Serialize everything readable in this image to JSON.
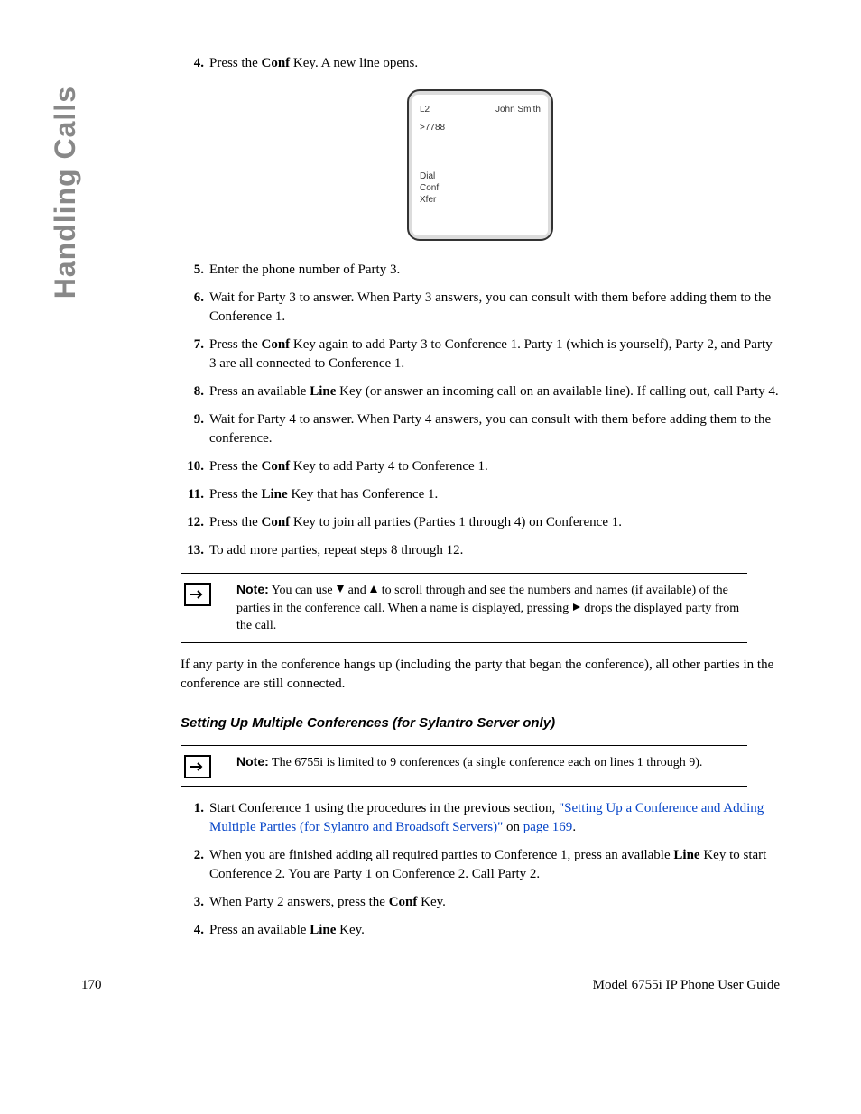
{
  "sideTitle": "Handling Calls",
  "phone": {
    "line": "L2",
    "name": "John Smith",
    "number": ">7788",
    "softkeys": [
      "Dial",
      "Conf",
      "Xfer"
    ]
  },
  "stepsA": [
    {
      "n": "4.",
      "pre": "Press the ",
      "bold": "Conf",
      "post": " Key. A new line opens."
    },
    {
      "n": "5.",
      "pre": "Enter the phone number of Party 3.",
      "bold": "",
      "post": ""
    },
    {
      "n": "6.",
      "pre": "Wait for Party 3 to answer. When Party 3 answers, you can consult with them before adding them to the Conference 1.",
      "bold": "",
      "post": ""
    },
    {
      "n": "7.",
      "pre": "Press the ",
      "bold": "Conf",
      "post": " Key again to add Party 3 to Conference 1. Party 1 (which is yourself), Party 2, and Party 3 are all connected to Conference 1."
    },
    {
      "n": "8.",
      "pre": "Press an available ",
      "bold": "Line",
      "post": " Key (or answer an incoming call on an available line). If calling out, call Party 4."
    },
    {
      "n": "9.",
      "pre": "Wait for Party 4 to answer. When Party 4 answers, you can consult with them before adding them to the conference.",
      "bold": "",
      "post": ""
    },
    {
      "n": "10.",
      "pre": "Press the ",
      "bold": "Conf",
      "post": " Key to add Party 4 to Conference 1."
    },
    {
      "n": "11.",
      "pre": "Press the ",
      "bold": "Line",
      "post": " Key that has Conference 1."
    },
    {
      "n": "12.",
      "pre": "Press the ",
      "bold": "Conf",
      "post": " Key to join all parties (Parties 1 through 4) on Conference 1."
    },
    {
      "n": "13.",
      "pre": "To add more parties, repeat steps 8 through 12.",
      "bold": "",
      "post": ""
    }
  ],
  "note1": {
    "label": "Note:",
    "t1": " You can use ",
    "t2": " and ",
    "t3": " to scroll through and see the numbers and names (if available) of the parties in the conference call. When a name is displayed, pressing ",
    "t4": " drops the displayed party from the call."
  },
  "para1": "If any party in the conference hangs up (including the party that began the conference), all other parties in the conference are still connected.",
  "subhead": "Setting Up Multiple Conferences (for Sylantro Server only)",
  "note2": {
    "label": "Note:",
    "text": " The 6755i is limited to 9 conferences (a single conference each on lines 1 through 9)."
  },
  "stepsB": [
    {
      "n": "1.",
      "pre": "Start Conference 1 using the procedures in the previous section, ",
      "link1": "\"Setting Up a Conference and Adding Multiple Parties (for Sylantro and Broadsoft Servers)\"",
      "mid": " on ",
      "link2": "page 169",
      "post": "."
    },
    {
      "n": "2.",
      "pre": "When you are finished adding all required parties to Conference 1, press an available ",
      "bold": "Line",
      "post": " Key to start Conference 2. You are Party 1 on Conference 2. Call Party 2."
    },
    {
      "n": "3.",
      "pre": "When Party 2 answers, press the ",
      "bold": "Conf",
      "post": " Key."
    },
    {
      "n": "4.",
      "pre": "Press an available ",
      "bold": "Line",
      "post": " Key."
    }
  ],
  "footer": {
    "page": "170",
    "title": "Model 6755i IP Phone User Guide"
  }
}
